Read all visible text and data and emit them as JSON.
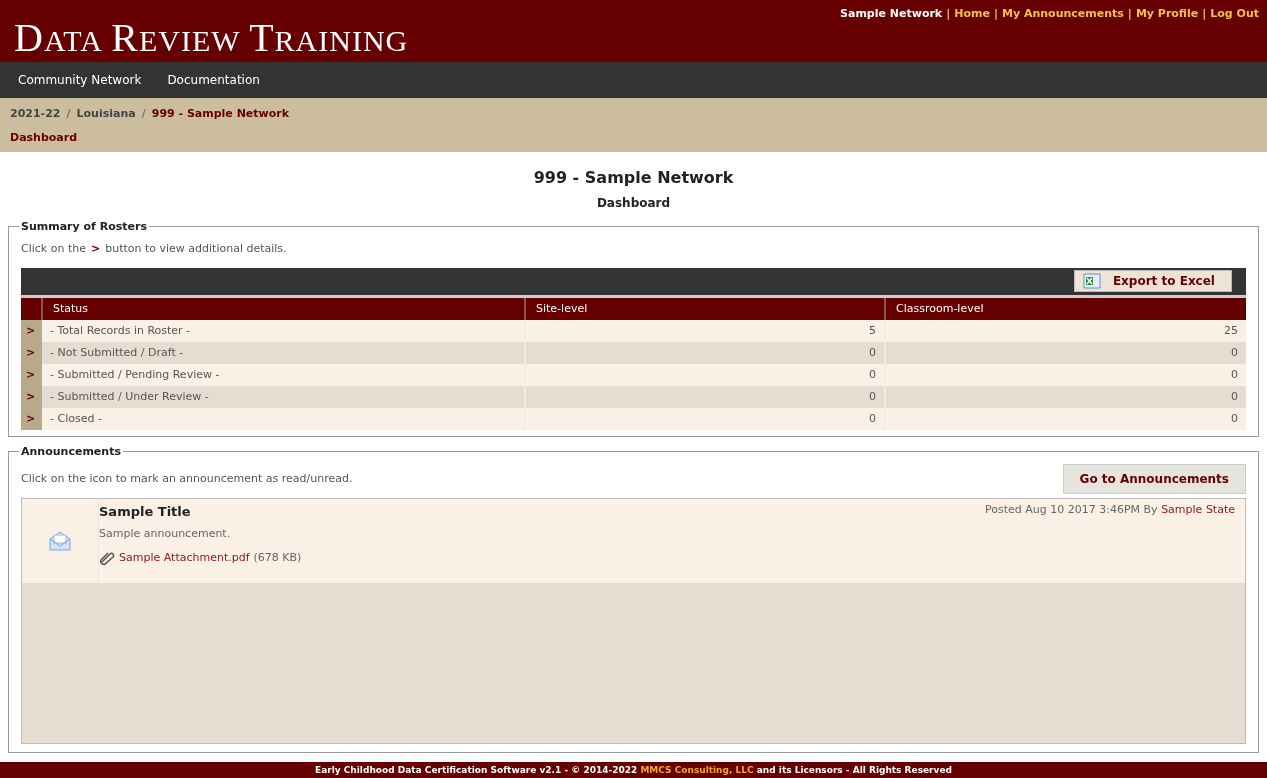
{
  "header": {
    "title": "DATA REVIEW TRAINING",
    "user_links": [
      {
        "label": "Sample Network",
        "kind": "user"
      },
      {
        "label": "Home",
        "kind": "link"
      },
      {
        "label": "My Announcements",
        "kind": "link"
      },
      {
        "label": "My Profile",
        "kind": "link"
      },
      {
        "label": "Log Out",
        "kind": "link"
      }
    ],
    "link_separator": "|"
  },
  "nav": [
    "Community Network",
    "Documentation"
  ],
  "breadcrumb": {
    "separator": "/",
    "items": [
      {
        "label": "2021-22",
        "active": false
      },
      {
        "label": "Louisiana",
        "active": false
      },
      {
        "label": "999 - Sample Network",
        "active": true
      }
    ],
    "page": "Dashboard"
  },
  "page_title": "999 - Sample Network",
  "page_subtitle": "Dashboard",
  "summary": {
    "legend": "Summary of Rosters",
    "hint_before": "Click on the",
    "hint_icon": ">",
    "hint_after": "button to view additional details.",
    "export_button": "Export to Excel",
    "columns": [
      "Status",
      "Site-level",
      "Classroom-level"
    ],
    "rows": [
      {
        "expand": ">",
        "status": "- Total Records in Roster -",
        "site": "5",
        "classroom": "25"
      },
      {
        "expand": ">",
        "status": "- Not Submitted / Draft -",
        "site": "0",
        "classroom": "0"
      },
      {
        "expand": ">",
        "status": "- Submitted / Pending Review -",
        "site": "0",
        "classroom": "0"
      },
      {
        "expand": ">",
        "status": "- Submitted / Under Review -",
        "site": "0",
        "classroom": "0"
      },
      {
        "expand": ">",
        "status": "- Closed -",
        "site": "0",
        "classroom": "0"
      }
    ]
  },
  "announcements": {
    "legend": "Announcements",
    "hint": "Click on the icon to mark an announcement as read/unread.",
    "button": "Go to Announcements",
    "items": [
      {
        "title": "Sample Title",
        "read": true,
        "posted": "Posted Aug 10 2017 3:46PM By",
        "author": "Sample State",
        "body": "Sample announcement.",
        "attachment": "Sample Attachment.pdf",
        "size": "(678 KB)"
      }
    ]
  },
  "footer": {
    "before": "Early Childhood Data Certification Software v2.1 - © 2014-2022",
    "link": "MMCS Consulting, LLC",
    "after": "and its Licensors - All Rights Reserved"
  }
}
